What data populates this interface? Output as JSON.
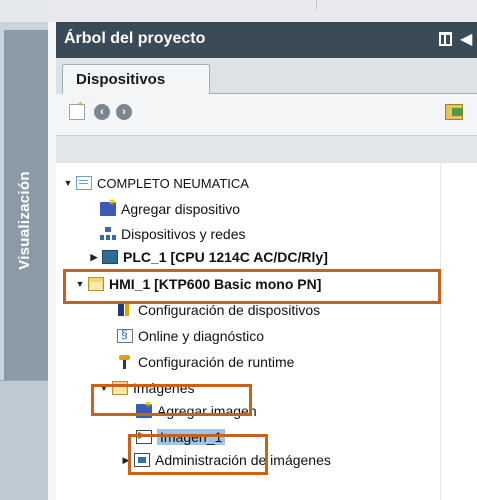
{
  "side_panel": {
    "vertical_label": "Visualización"
  },
  "title_bar": {
    "title": "Árbol del proyecto",
    "icons": [
      "pin-icon",
      "collapse-left-icon"
    ]
  },
  "tabs": [
    {
      "label": "Dispositivos",
      "active": true
    }
  ],
  "toolbar": {
    "icons": [
      "new-folder-icon",
      "back-icon",
      "forward-icon",
      "overview-icon"
    ]
  },
  "tree": {
    "project": "COMPLETO NEUMATICA",
    "add_device": "Agregar dispositivo",
    "devices_networks": "Dispositivos y redes",
    "plc": "PLC_1 [CPU 1214C AC/DC/Rly]",
    "hmi": "HMI_1 [KTP600 Basic mono PN]",
    "device_config": "Configuración de dispositivos",
    "online_diag": "Online y diagnóstico",
    "runtime_config": "Configuración de runtime",
    "images_folder": "Imágenes",
    "add_image": "Agregar imagen",
    "image_1": "Imagen_1",
    "image_admin": "Administración de imágenes"
  },
  "colors": {
    "title_bar": "#3a4a56",
    "highlight_box": "#c8621b",
    "selection": "#9cc5e8"
  }
}
